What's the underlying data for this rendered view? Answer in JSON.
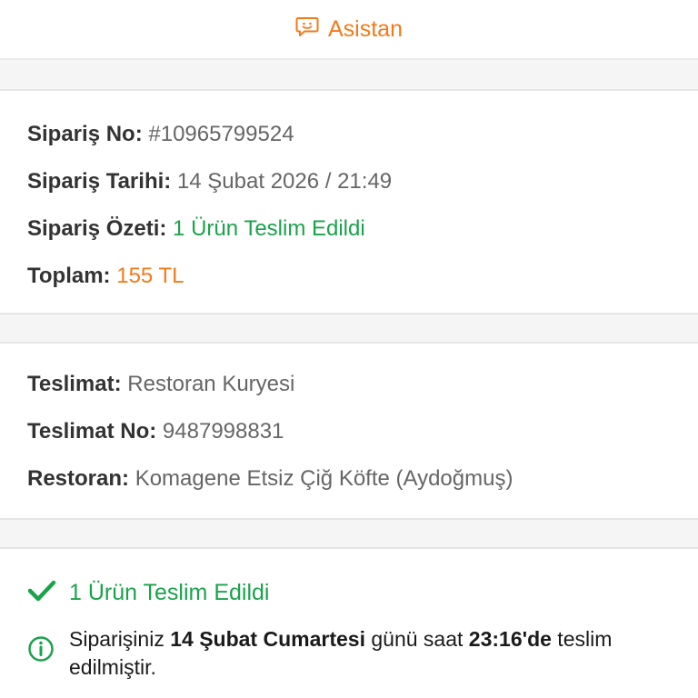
{
  "header": {
    "title": "Asistan",
    "icon": "chat-bubble-icon",
    "accent": "#f27a1a"
  },
  "order": {
    "number_label": "Sipariş No:",
    "number_value": "#10965799524",
    "date_label": "Sipariş Tarihi:",
    "date_value": "14 Şubat 2026 / 21:49",
    "summary_label": "Sipariş Özeti:",
    "summary_value": "1 Ürün Teslim Edildi",
    "total_label": "Toplam:",
    "total_value": "155 TL"
  },
  "delivery": {
    "type_label": "Teslimat:",
    "type_value": "Restoran Kuryesi",
    "number_label": "Teslimat No:",
    "number_value": "9487998831",
    "restaurant_label": "Restoran:",
    "restaurant_value": "Komagene Etsiz Çiğ Köfte (Aydoğmuş)"
  },
  "status": {
    "icon": "checkmark-icon",
    "title": "1 Ürün Teslim Edildi",
    "color": "#1aa34a",
    "info_icon": "info-icon",
    "message_part1": "Siparişiniz ",
    "message_date": "14 Şubat Cumartesi",
    "message_part2": " günü saat ",
    "message_time": "23:16'de",
    "message_part3": " teslim edilmiştir."
  }
}
